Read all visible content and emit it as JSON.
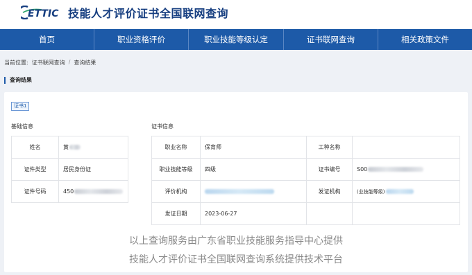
{
  "header": {
    "logo_text": "ETTIC",
    "site_title": "技能人才评价证书全国联网查询"
  },
  "nav": [
    "首页",
    "职业资格评价",
    "职业技能等级认定",
    "证书联网查询",
    "相关政策文件"
  ],
  "breadcrumb": {
    "prefix": "当前位置:",
    "items": [
      "证书联网查询",
      "查询结果"
    ],
    "separator": "/"
  },
  "section_title": "查询结果",
  "cert_tab": "证书1",
  "basic": {
    "title": "基础信息",
    "rows": [
      {
        "label": "姓名",
        "value": "黄"
      },
      {
        "label": "证件类型",
        "value": "居民身份证"
      },
      {
        "label": "证件号码",
        "value": "450"
      }
    ]
  },
  "cert": {
    "title": "证书信息",
    "occupation_label": "职业名称",
    "occupation_value": "保育师",
    "trade_label": "工种名称",
    "trade_value": "",
    "level_label": "职业技能等级",
    "level_value": "四级",
    "cert_no_label": "证书编号",
    "cert_no_value": "S00",
    "eval_org_label": "评价机构",
    "eval_org_value": "",
    "issue_org_label": "发证机构",
    "issue_org_value": "(业技能等级)",
    "issue_date_label": "发证日期",
    "issue_date_value": "2023-06-27"
  },
  "footer": {
    "line1": "以上查询服务由广东省职业技能服务指导中心提供",
    "line2": "技能人才评价证书全国联网查询系统提供技术平台"
  }
}
